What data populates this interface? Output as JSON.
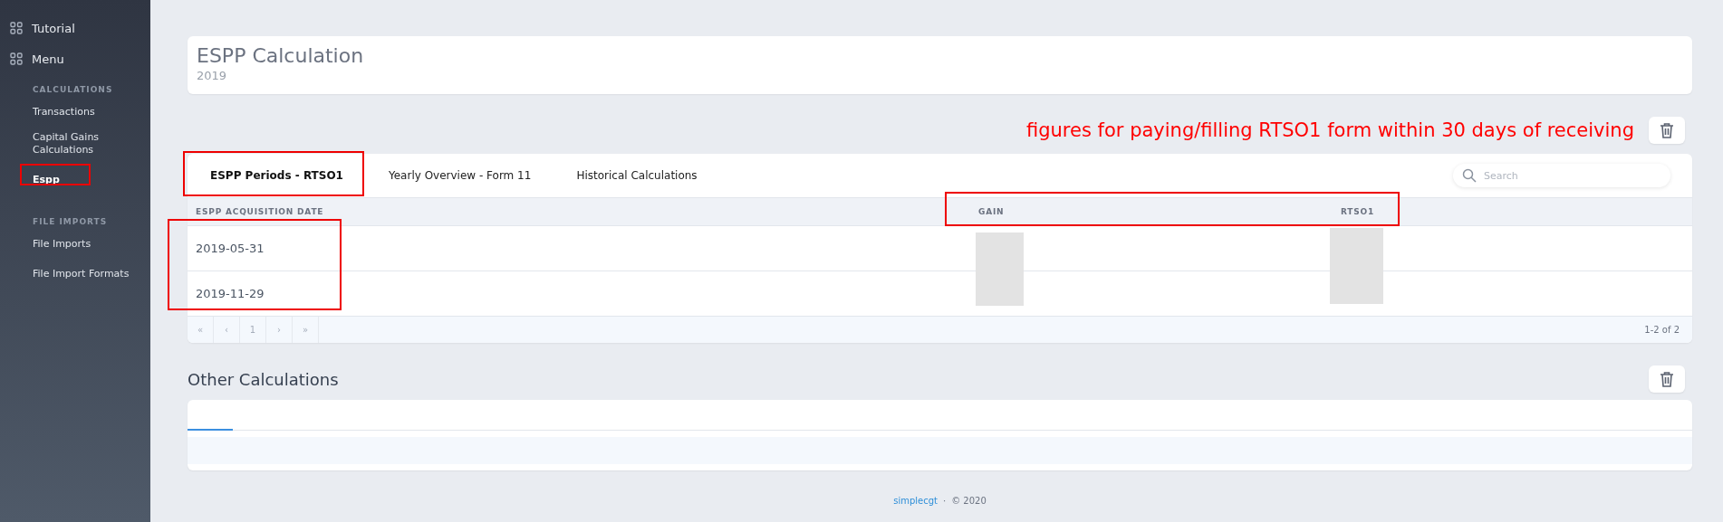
{
  "sidebar": {
    "top_items": [
      {
        "label": "Tutorial"
      },
      {
        "label": "Menu"
      }
    ],
    "sections": [
      {
        "title": "CALCULATIONS",
        "items": [
          {
            "label": "Transactions",
            "selected": false,
            "highlighted": false
          },
          {
            "label": "Capital Gains Calculations",
            "selected": false,
            "highlighted": false
          },
          {
            "label": "Espp",
            "selected": true,
            "highlighted": true
          }
        ]
      },
      {
        "title": "FILE IMPORTS",
        "items": [
          {
            "label": "File Imports",
            "selected": false,
            "highlighted": false
          },
          {
            "label": "File Import Formats",
            "selected": false,
            "highlighted": false
          }
        ]
      }
    ]
  },
  "header": {
    "title": "ESPP Calculation",
    "subtitle": "2019"
  },
  "annotation": "figures for paying/filling RTSO1 form within 30 days of receiving",
  "periods_card": {
    "tabs": [
      {
        "label": "ESPP Periods - RTSO1",
        "selected": true,
        "highlighted": true
      },
      {
        "label": "Yearly Overview - Form 11",
        "selected": false,
        "highlighted": false
      },
      {
        "label": "Historical Calculations",
        "selected": false,
        "highlighted": false
      }
    ],
    "search": {
      "placeholder": "Search"
    },
    "table": {
      "columns": [
        {
          "label": "ESPP ACQUISITION DATE"
        },
        {
          "label": "GAIN"
        },
        {
          "label": "RTSO1"
        }
      ],
      "value_columns_highlighted": true,
      "dates_highlighted": true,
      "values_redacted": true,
      "rows": [
        {
          "date": "2019-05-31"
        },
        {
          "date": "2019-11-29"
        }
      ]
    },
    "pagination": {
      "buttons": [
        "«",
        "‹",
        "1",
        "›",
        "»"
      ],
      "summary": "1-2 of 2"
    }
  },
  "other": {
    "title": "Other Calculations"
  },
  "footer": {
    "link": "simplecgt",
    "separator": "·",
    "copyright": "© 2020"
  }
}
